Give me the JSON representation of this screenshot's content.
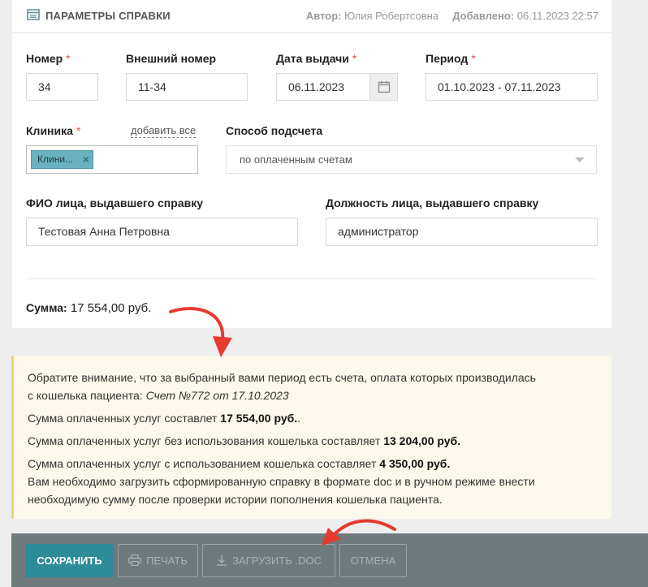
{
  "header": {
    "title": "ПАРАМЕТРЫ СПРАВКИ",
    "author_label": "Автор:",
    "author_value": "Юлия Робертсовна",
    "added_label": "Добавлено:",
    "added_value": "06.11.2023 22:57"
  },
  "form": {
    "number": {
      "label": "Номер",
      "value": "34"
    },
    "external_number": {
      "label": "Внешний номер",
      "value": "11-34"
    },
    "issue_date": {
      "label": "Дата выдачи",
      "value": "06.11.2023"
    },
    "period": {
      "label": "Период",
      "value": "01.10.2023 - 07.11.2023"
    },
    "clinic": {
      "label": "Клиника",
      "add_all": "добавить все",
      "tag": "Клини...",
      "tag_remove": "×"
    },
    "calc_method": {
      "label": "Способ подсчета",
      "value": "по оплаченным счетам"
    },
    "issuer_name": {
      "label": "ФИО лица, выдавшего справку",
      "value": "Тестовая Анна Петровна"
    },
    "issuer_position": {
      "label": "Должность лица, выдавшего справку",
      "value": "администратор"
    },
    "required_mark": "*"
  },
  "sum": {
    "label": "Сумма:",
    "value": "17 554,00 руб."
  },
  "notice": {
    "line1": "Обратите внимание, что за выбранный вами период есть счета, оплата которых производилась",
    "line2_prefix": "с кошелька пациента: ",
    "line2_invoice": "Счет №772 от 17.10.2023",
    "paid_prefix": "Сумма оплаченных услуг составлет ",
    "paid_value": "17 554,00 руб.",
    "paid_suffix": ".",
    "no_wallet_prefix": "Сумма оплаченных услуг без использования кошелька составляет ",
    "no_wallet_value": "13 204,00 руб.",
    "wallet_prefix": "Сумма оплаченных услуг с использованием кошелька составляет ",
    "wallet_value": "4 350,00 руб.",
    "instruction_line1": "Вам необходимо загрузить сформированную справку в формате doc и в ручном режиме внести",
    "instruction_line2": "необходимую сумму после проверки истории пополнения кошелька пациента."
  },
  "footer": {
    "save": "СОХРАНИТЬ",
    "print": "ПЕЧАТЬ",
    "download_doc": "ЗАГРУЗИТЬ .DOC",
    "cancel": "ОТМЕНА"
  },
  "colors": {
    "accent": "#2e8b98",
    "required": "#e0514d",
    "notice_bg": "#fcf8ec",
    "notice_border": "#f0d56e",
    "footer_bg": "#6f7a7d",
    "annotation_arrow": "#e53a2f"
  },
  "icons": {
    "header": "document-icon",
    "date": "calendar-icon",
    "select": "chevron-down-icon",
    "print": "printer-icon",
    "download": "download-icon"
  }
}
